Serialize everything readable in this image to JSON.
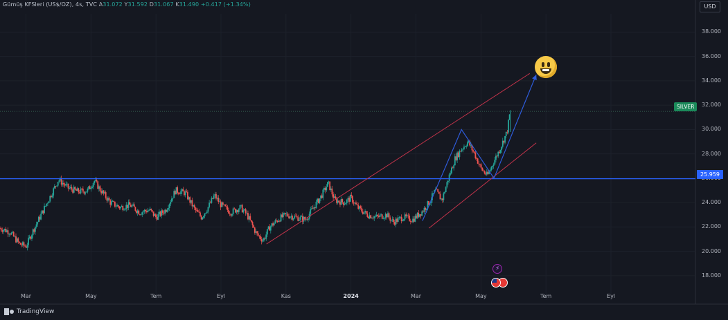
{
  "header": {
    "title": "Gümüş KFSleri (US$/OZ), 4s, TVC",
    "o_key": "A",
    "o_val": "31.072",
    "h_key": "Y",
    "h_val": "31.592",
    "l_key": "D",
    "l_val": "31.067",
    "c_key": "K",
    "c_val": "31.490",
    "change": "+0.417 (+1.34%)"
  },
  "currency_button": "USD",
  "price_labels": {
    "symbol": "SILVER",
    "level": "25.959"
  },
  "brand": "TradingView",
  "colors": {
    "up": "#26a69a",
    "down": "#ef5350",
    "level_line": "#2962ff",
    "channel": "#c2334a",
    "arrow": "#2e5bd9",
    "background": "#151821"
  },
  "chart_data": {
    "type": "candlestick",
    "title": "Gümüş KFSleri (US$/OZ), 4s, TVC",
    "y_ticks": [
      "18.000",
      "20.000",
      "22.000",
      "24.000",
      "26.000",
      "28.000",
      "30.000",
      "32.000",
      "34.000",
      "36.000",
      "38.000"
    ],
    "ylim": [
      16.8,
      39.5
    ],
    "x_ticks": [
      {
        "label": "Mar",
        "x": 1.6
      },
      {
        "label": "May",
        "x": 3.6
      },
      {
        "label": "Tem",
        "x": 5.6
      },
      {
        "label": "Eyl",
        "x": 7.6
      },
      {
        "label": "Kas",
        "x": 9.6
      },
      {
        "label": "2024",
        "x": 11.6,
        "bold": true
      },
      {
        "label": "Mar",
        "x": 13.6
      },
      {
        "label": "May",
        "x": 15.6
      },
      {
        "label": "Tem",
        "x": 17.6
      },
      {
        "label": "Eyl",
        "x": 19.6
      }
    ],
    "xlim": [
      0.8,
      22.2
    ],
    "price_path": [
      [
        0.8,
        21.9
      ],
      [
        1.1,
        21.6
      ],
      [
        1.4,
        20.6
      ],
      [
        1.6,
        20.4
      ],
      [
        1.8,
        21.6
      ],
      [
        2.1,
        23.2
      ],
      [
        2.4,
        24.8
      ],
      [
        2.6,
        25.9
      ],
      [
        2.9,
        25.2
      ],
      [
        3.2,
        24.9
      ],
      [
        3.5,
        25.0
      ],
      [
        3.7,
        25.8
      ],
      [
        3.9,
        25.0
      ],
      [
        4.2,
        24.0
      ],
      [
        4.5,
        23.6
      ],
      [
        4.8,
        23.8
      ],
      [
        5.1,
        23.2
      ],
      [
        5.4,
        23.4
      ],
      [
        5.6,
        22.8
      ],
      [
        5.9,
        23.4
      ],
      [
        6.2,
        25.0
      ],
      [
        6.5,
        24.8
      ],
      [
        6.8,
        23.4
      ],
      [
        7.0,
        22.8
      ],
      [
        7.2,
        23.6
      ],
      [
        7.4,
        24.6
      ],
      [
        7.6,
        23.8
      ],
      [
        7.9,
        23.2
      ],
      [
        8.2,
        23.6
      ],
      [
        8.4,
        23.0
      ],
      [
        8.7,
        21.4
      ],
      [
        8.9,
        20.9
      ],
      [
        9.1,
        22.0
      ],
      [
        9.4,
        22.7
      ],
      [
        9.6,
        23.0
      ],
      [
        9.9,
        22.8
      ],
      [
        10.2,
        22.6
      ],
      [
        10.5,
        23.8
      ],
      [
        10.7,
        24.6
      ],
      [
        10.9,
        25.6
      ],
      [
        11.1,
        24.2
      ],
      [
        11.4,
        24.0
      ],
      [
        11.6,
        24.4
      ],
      [
        11.8,
        23.6
      ],
      [
        12.1,
        23.0
      ],
      [
        12.4,
        22.8
      ],
      [
        12.7,
        23.0
      ],
      [
        12.9,
        22.4
      ],
      [
        13.2,
        22.8
      ],
      [
        13.5,
        22.6
      ],
      [
        13.8,
        23.3
      ],
      [
        14.0,
        24.0
      ],
      [
        14.2,
        25.0
      ],
      [
        14.4,
        24.2
      ],
      [
        14.6,
        26.0
      ],
      [
        14.8,
        27.6
      ],
      [
        15.0,
        28.4
      ],
      [
        15.2,
        29.0
      ],
      [
        15.4,
        28.0
      ],
      [
        15.6,
        26.8
      ],
      [
        15.8,
        26.2
      ],
      [
        16.0,
        27.4
      ],
      [
        16.2,
        28.5
      ],
      [
        16.4,
        29.8
      ],
      [
        16.5,
        31.5
      ]
    ],
    "level": 25.959,
    "channel_upper": [
      [
        9.0,
        20.6
      ],
      [
        17.1,
        34.6
      ]
    ],
    "channel_lower": [
      [
        14.0,
        21.9
      ],
      [
        17.3,
        28.9
      ]
    ],
    "pattern_arrow": [
      [
        13.8,
        22.5
      ],
      [
        15.0,
        30.0
      ],
      [
        16.0,
        26.0
      ],
      [
        17.3,
        34.5
      ]
    ],
    "last_price": 31.49
  }
}
